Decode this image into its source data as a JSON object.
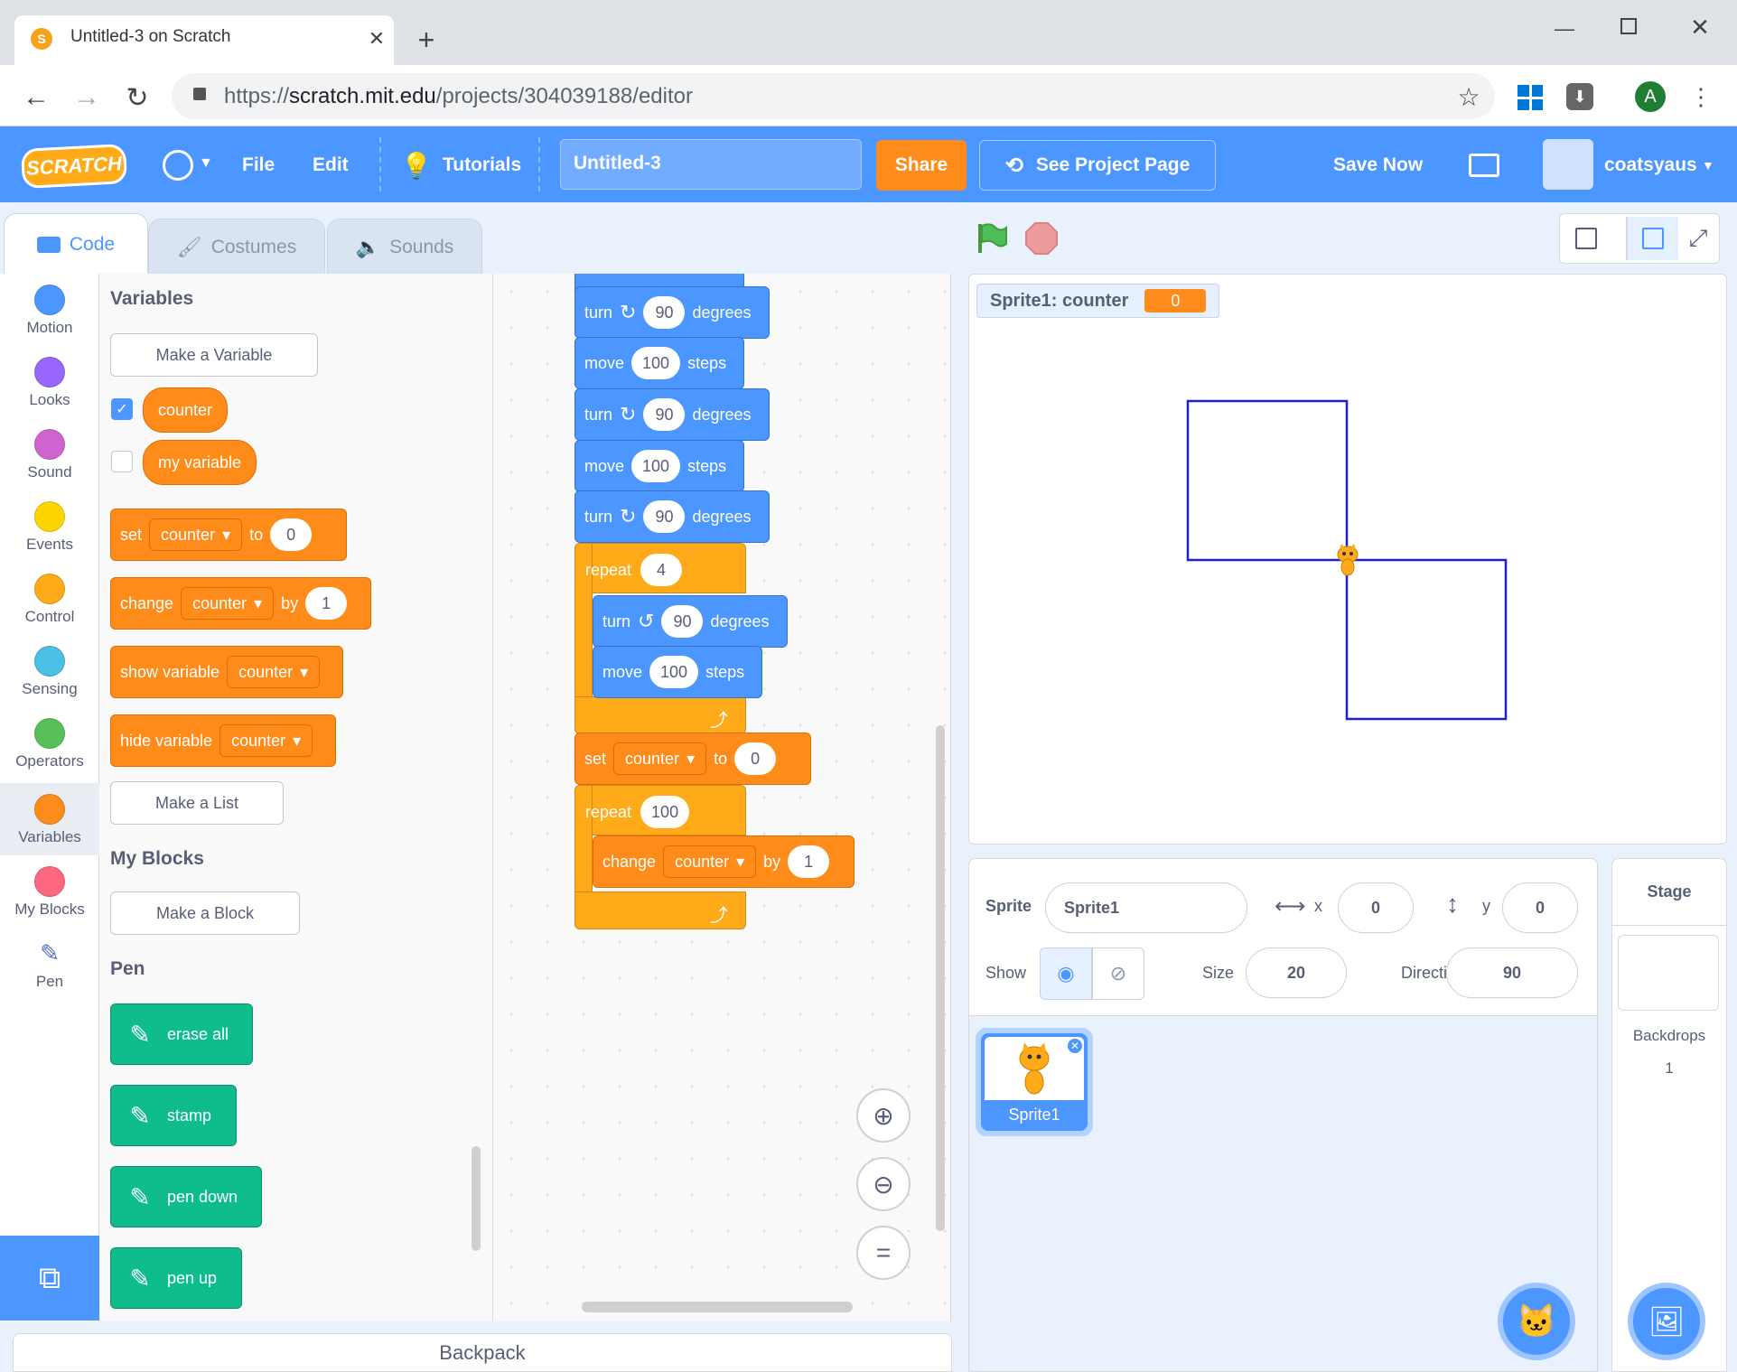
{
  "browser": {
    "tab_title": "Untitled-3 on Scratch",
    "url_scheme": "https://",
    "url_host": "scratch.mit.edu",
    "url_path": "/projects/304039188/editor",
    "profile_initial": "A"
  },
  "menubar": {
    "logo": "SCRATCH",
    "file": "File",
    "edit": "Edit",
    "tutorials": "Tutorials",
    "project_title": "Untitled-3",
    "share": "Share",
    "see_project": "See Project Page",
    "save_now": "Save Now",
    "username": "coatsyaus"
  },
  "tabs": {
    "code": "Code",
    "costumes": "Costumes",
    "sounds": "Sounds"
  },
  "categories": [
    {
      "label": "Motion",
      "color": "#4c97ff"
    },
    {
      "label": "Looks",
      "color": "#9966ff"
    },
    {
      "label": "Sound",
      "color": "#cf63cf"
    },
    {
      "label": "Events",
      "color": "#ffd500"
    },
    {
      "label": "Control",
      "color": "#ffab19"
    },
    {
      "label": "Sensing",
      "color": "#4cbfe6"
    },
    {
      "label": "Operators",
      "color": "#59c059"
    },
    {
      "label": "Variables",
      "color": "#ff8c1a"
    },
    {
      "label": "My Blocks",
      "color": "#ff6680"
    },
    {
      "label": "Pen",
      "color": ""
    }
  ],
  "palette": {
    "variables_heading": "Variables",
    "make_variable": "Make a Variable",
    "var1": "counter",
    "var2": "my variable",
    "set": {
      "word": "set",
      "var": "counter",
      "to": "to",
      "value": "0"
    },
    "change": {
      "word": "change",
      "var": "counter",
      "by": "by",
      "value": "1"
    },
    "show": {
      "word": "show variable",
      "var": "counter"
    },
    "hide": {
      "word": "hide variable",
      "var": "counter"
    },
    "make_list": "Make a List",
    "myblocks_heading": "My Blocks",
    "make_block": "Make a Block",
    "pen_heading": "Pen",
    "pen_blocks": [
      "erase all",
      "stamp",
      "pen down",
      "pen up"
    ]
  },
  "script": {
    "turn": "turn",
    "move": "move",
    "degrees": "degrees",
    "steps": "steps",
    "deg_value": "90",
    "step_value": "100",
    "repeat": "repeat",
    "repeat_count": "4",
    "set": "set",
    "var": "counter",
    "to": "to",
    "set_value": "0",
    "repeat2_count": "100",
    "change": "change",
    "by": "by",
    "change_value": "1"
  },
  "stage": {
    "monitor_label": "Sprite1: counter",
    "monitor_value": "0"
  },
  "sprite_info": {
    "sprite_label": "Sprite",
    "sprite_name": "Sprite1",
    "x_label": "x",
    "x": "0",
    "y_label": "y",
    "y": "0",
    "show_label": "Show",
    "size_label": "Size",
    "size": "20",
    "direction_label": "Direction",
    "direction": "90"
  },
  "sprite_list": [
    {
      "name": "Sprite1"
    }
  ],
  "stage_panel": {
    "title": "Stage",
    "backdrops_label": "Backdrops",
    "backdrops_count": "1"
  },
  "backpack": "Backpack"
}
